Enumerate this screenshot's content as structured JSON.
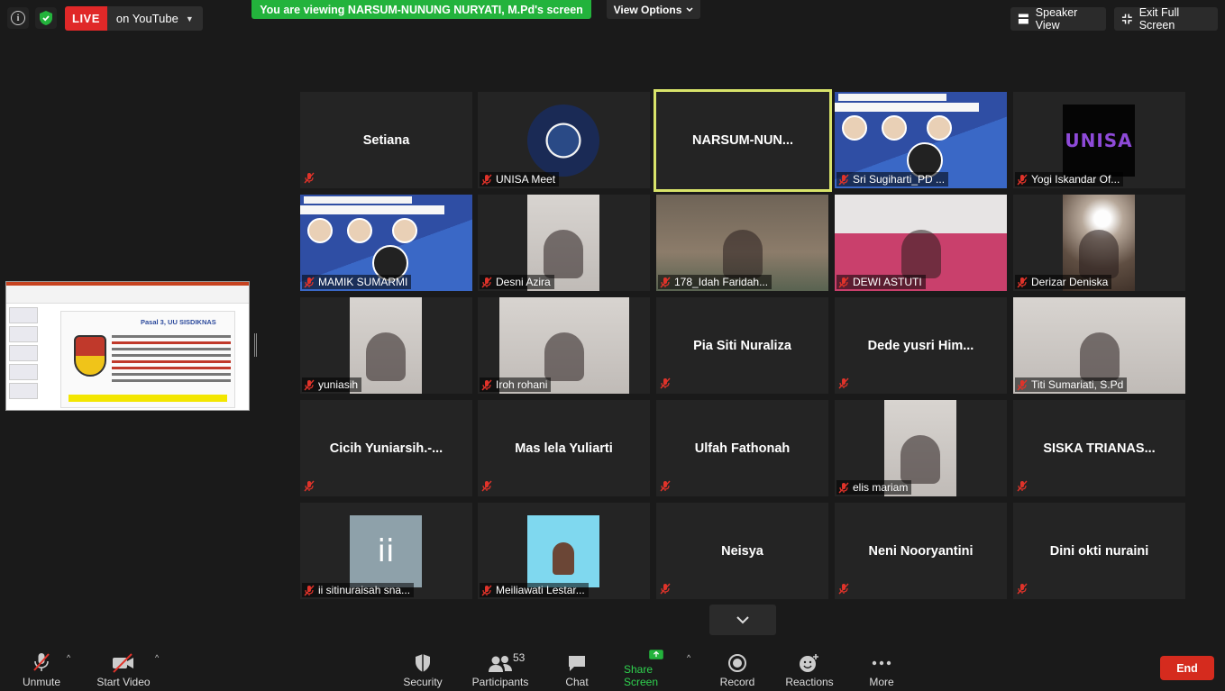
{
  "topbar": {
    "live_label": "LIVE",
    "live_destination": "on YouTube",
    "viewing_banner": "You are viewing NARSUM-NUNUNG NURYATI, M.Pd's screen",
    "view_options": "View Options",
    "speaker_view": "Speaker View",
    "exit_full_screen": "Exit Full Screen"
  },
  "shared_slide": {
    "title": "Pasal 3, UU SISDIKNAS"
  },
  "gallery": [
    {
      "name": "Setiana",
      "label": ""
    },
    {
      "name": "",
      "label": "UNISA Meet"
    },
    {
      "name": "NARSUM-NUN...",
      "label": ""
    },
    {
      "name": "",
      "label": "Sri Sugiharti_PD ..."
    },
    {
      "name": "",
      "label": "Yogi Iskandar Of..."
    },
    {
      "name": "",
      "label": "MAMIK SUMARMI"
    },
    {
      "name": "",
      "label": "Desni Azira"
    },
    {
      "name": "",
      "label": "178_Idah Faridah..."
    },
    {
      "name": "",
      "label": "DEWI ASTUTI"
    },
    {
      "name": "",
      "label": "Derizar Deniska"
    },
    {
      "name": "",
      "label": "yuniasih"
    },
    {
      "name": "",
      "label": "Iroh rohani"
    },
    {
      "name": "Pia Siti Nuraliza",
      "label": ""
    },
    {
      "name": "Dede  yusri  Him...",
      "label": ""
    },
    {
      "name": "",
      "label": "Titi Sumariati, S.Pd"
    },
    {
      "name": "Cicih  Yuniarsih.-...",
      "label": ""
    },
    {
      "name": "Mas lela Yuliarti",
      "label": ""
    },
    {
      "name": "Ulfah Fathonah",
      "label": ""
    },
    {
      "name": "",
      "label": "elis mariam"
    },
    {
      "name": "SISKA  TRIANAS...",
      "label": ""
    },
    {
      "name": "",
      "label": "ii sitinuraisah sna..."
    },
    {
      "name": "",
      "label": "Meiliawati Lestar..."
    },
    {
      "name": "Neisya",
      "label": ""
    },
    {
      "name": "Neni Nooryantini",
      "label": ""
    },
    {
      "name": "Dini okti nuraini",
      "label": ""
    }
  ],
  "avatar_initials": "ii",
  "unisa_logo_text": "UNISA",
  "toolbar": {
    "unmute": "Unmute",
    "start_video": "Start Video",
    "security": "Security",
    "participants": "Participants",
    "participants_count": "53",
    "chat": "Chat",
    "share_screen": "Share Screen",
    "record": "Record",
    "reactions": "Reactions",
    "more": "More",
    "end": "End"
  },
  "colors": {
    "live_red": "#e02828",
    "banner_green": "#23b33c",
    "active_speaker_border": "#d8e36a",
    "share_green": "#2fd24f",
    "end_red": "#d52b1e"
  }
}
